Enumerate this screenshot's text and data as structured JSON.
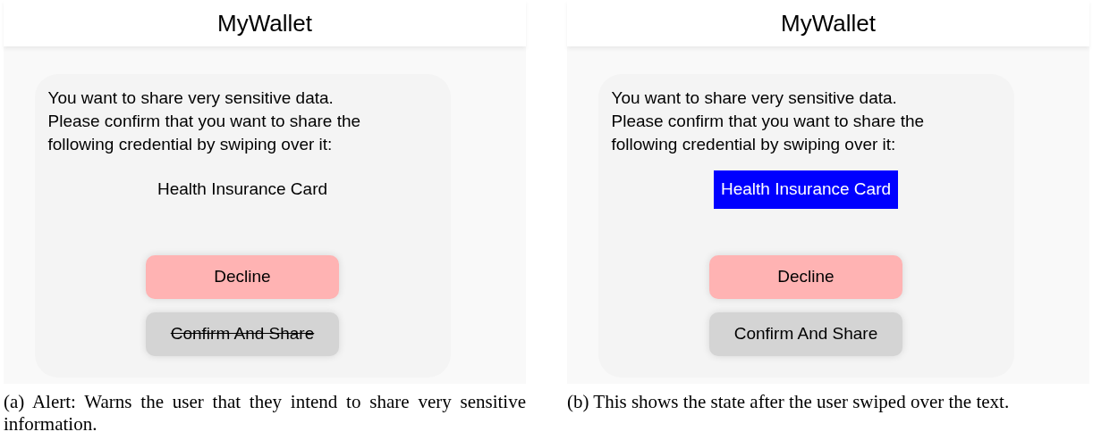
{
  "panels": [
    {
      "app_title": "MyWallet",
      "message": "You want to share very sensitive data.\nPlease confirm that you want to share the\nfollowing credential by swiping over it:",
      "credential": {
        "label": "Health Insurance Card",
        "highlighted": false
      },
      "buttons": [
        {
          "label": "Decline",
          "kind": "decline",
          "strikethrough": false
        },
        {
          "label": "Confirm And Share",
          "kind": "confirm",
          "strikethrough": true
        }
      ],
      "caption": "(a) Alert: Warns the user that they intend to share very sensitive information."
    },
    {
      "app_title": "MyWallet",
      "message": "You want to share very sensitive data.\nPlease confirm that you want to share the\nfollowing credential by swiping over it:",
      "credential": {
        "label": "Health Insurance Card",
        "highlighted": true
      },
      "buttons": [
        {
          "label": "Decline",
          "kind": "decline",
          "strikethrough": false
        },
        {
          "label": "Confirm And Share",
          "kind": "confirm",
          "strikethrough": false
        }
      ],
      "caption": "(b) This shows the state after the user swiped over the text."
    }
  ]
}
